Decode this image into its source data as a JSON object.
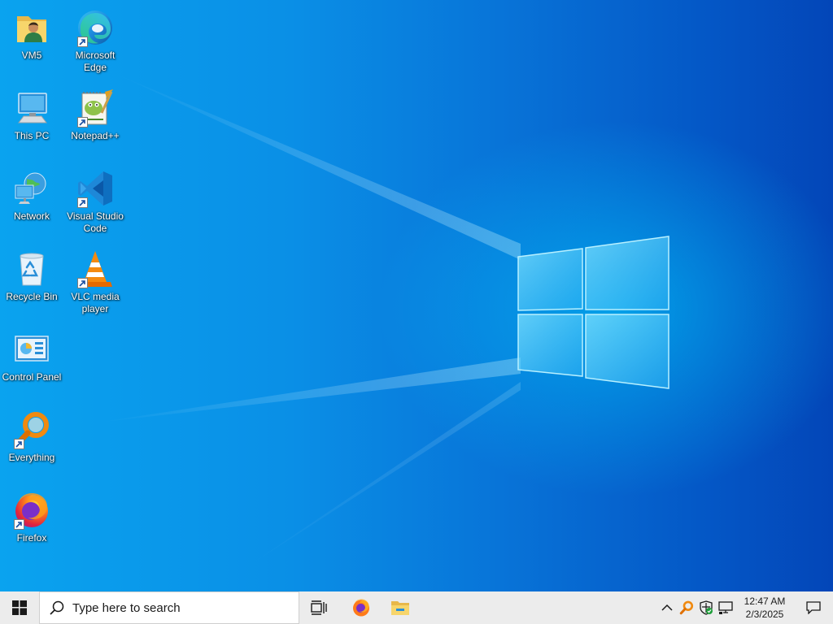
{
  "desktop": {
    "icons": [
      {
        "label": "VM5",
        "icon": "user-folder-icon"
      },
      {
        "label": "Microsoft Edge",
        "icon": "edge-icon"
      },
      {
        "label": "This PC",
        "icon": "computer-icon"
      },
      {
        "label": "Notepad++",
        "icon": "notepadpp-icon"
      },
      {
        "label": "Network",
        "icon": "network-icon"
      },
      {
        "label": "Visual Studio Code",
        "icon": "vscode-icon"
      },
      {
        "label": "Recycle Bin",
        "icon": "recycle-bin-icon"
      },
      {
        "label": "VLC media player",
        "icon": "vlc-icon"
      },
      {
        "label": "Control Panel",
        "icon": "control-panel-icon"
      },
      {
        "label": "Everything",
        "icon": "everything-icon"
      },
      {
        "label": "Firefox",
        "icon": "firefox-icon"
      }
    ]
  },
  "taskbar": {
    "search_placeholder": "Type here to search",
    "pinned": [
      {
        "icon": "task-view-icon"
      },
      {
        "icon": "firefox-icon"
      },
      {
        "icon": "file-explorer-icon"
      }
    ],
    "tray": {
      "time": "12:47 AM",
      "date": "2/3/2025",
      "icons": [
        "chevron-up-icon",
        "everything-icon",
        "security-icon",
        "network-icon"
      ]
    }
  },
  "colors": {
    "wallpaper_accent": "#0a8fe6",
    "taskbar_bg": "#ececec",
    "windows_logo": "#5fd4ff"
  }
}
